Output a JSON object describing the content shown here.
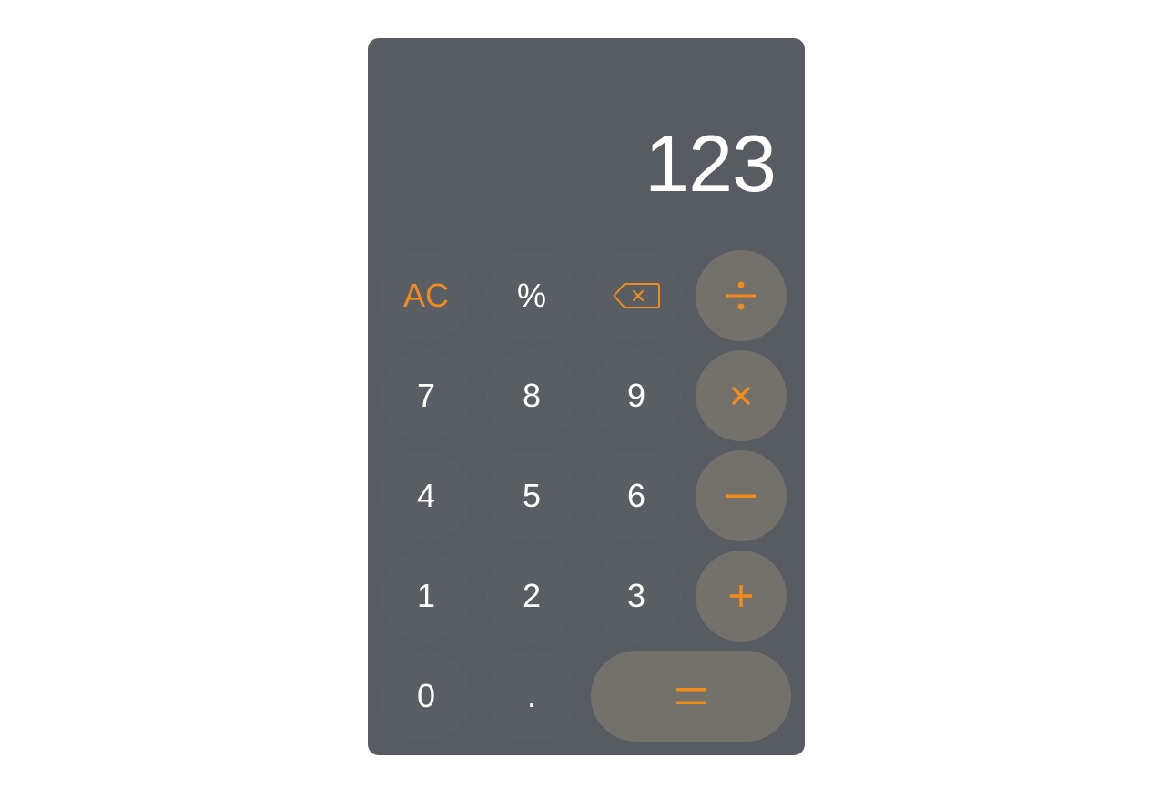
{
  "display": {
    "value": "123"
  },
  "keys": {
    "clear": "AC",
    "percent": "%",
    "backspace_icon": "backspace-icon",
    "divide_icon": "divide-icon",
    "multiply_icon": "multiply-icon",
    "minus_icon": "minus-icon",
    "plus_icon": "plus-icon",
    "equals_icon": "equals-icon",
    "seven": "7",
    "eight": "8",
    "nine": "9",
    "four": "4",
    "five": "5",
    "six": "6",
    "one": "1",
    "two": "2",
    "three": "3",
    "zero": "0",
    "decimal": "."
  },
  "colors": {
    "body": "#575c62",
    "operator_bg": "#74716b",
    "accent": "#f28a1c",
    "text": "#ffffff",
    "page_bg": "#ffffff"
  }
}
